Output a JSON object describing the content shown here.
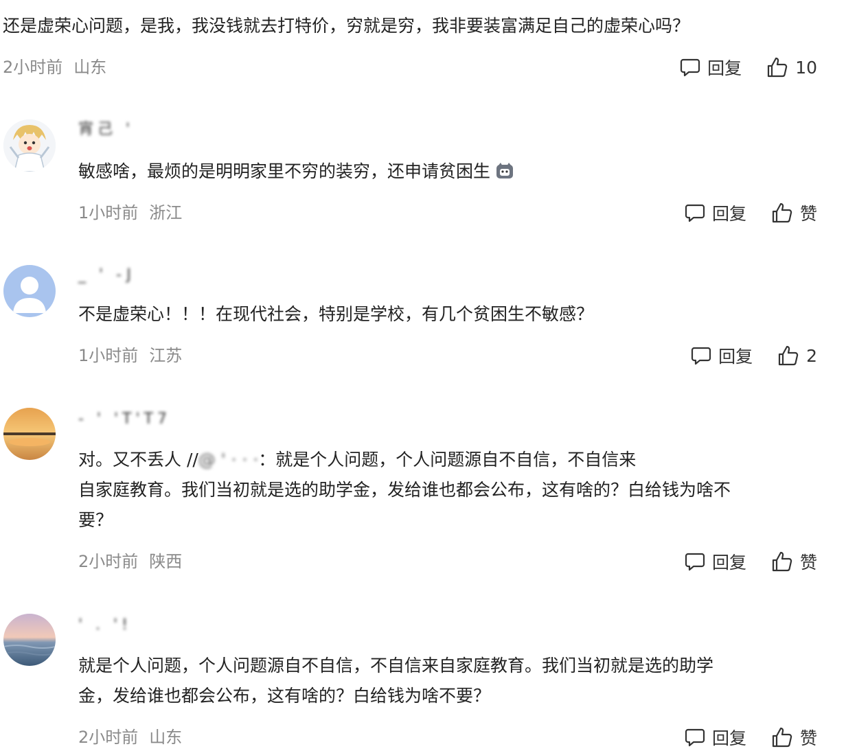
{
  "comments": [
    {
      "username": "",
      "lines": [
        "还是虚荣心问题，是我，我没钱就去打特价，穷就是穷，我非要装富满足自己的虚荣心吗？"
      ],
      "time": "2小时前",
      "location": "山东",
      "reply_label": "回复",
      "like_label": "10",
      "avatar_icon": ""
    },
    {
      "username": "宵己 '",
      "lines": [
        "敏感啥，最烦的是明明家里不穷的装穷，还申请贫困生"
      ],
      "emoji": "cat-emoji-icon",
      "time": "1小时前",
      "location": "浙江",
      "reply_label": "回复",
      "like_label": "赞",
      "avatar_icon": "anime-avatar-icon"
    },
    {
      "username": "_ ' -J",
      "lines": [
        "不是虚荣心！！！在现代社会，特别是学校，有几个贫困生不敏感？"
      ],
      "time": "1小时前",
      "location": "江苏",
      "reply_label": "回复",
      "like_label": "2",
      "avatar_icon": "default-user-avatar-icon"
    },
    {
      "username": "- ' 'T'T7 ",
      "lines_first_prefix": "对。又不丢人 //",
      "lines_first_blur": "@  ' · · ·",
      "lines_first_suffix": "：就是个人问题，个人问题源自不自信，不自信来",
      "lines": [
        "自家庭教育。我们当初就是选的助学金，发给谁也都会公布，这有啥的？白给钱为啥不",
        "要？"
      ],
      "time": "2小时前",
      "location": "陕西",
      "reply_label": "回复",
      "like_label": "赞",
      "avatar_icon": "sunset-avatar-icon"
    },
    {
      "username": "' .  '!",
      "lines": [
        "就是个人问题，个人问题源自不自信，不自信来自家庭教育。我们当初就是选的助学",
        "金，发给谁也都会公布，这有啥的？白给钱为啥不要？"
      ],
      "time": "2小时前",
      "location": "山东",
      "reply_label": "回复",
      "like_label": "赞",
      "avatar_icon": "sea-sunset-avatar-icon"
    }
  ],
  "colors": {
    "text": "#222222",
    "meta": "#8a8a8a",
    "background": "#ffffff"
  }
}
